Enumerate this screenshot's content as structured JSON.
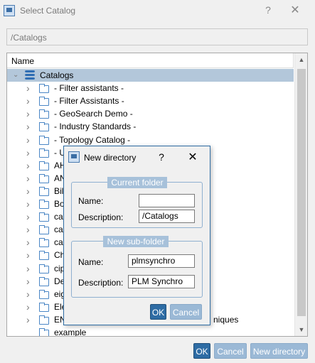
{
  "window": {
    "title": "Select Catalog",
    "help": "?",
    "close": "✕",
    "path": "/Catalogs"
  },
  "tree": {
    "header": "Name",
    "root_label": "Catalogs",
    "items": [
      "- Filter assistants -",
      "- Filter Assistants -",
      "- GeoSearch Demo -",
      "- Industry Standards -",
      "- Topology Catalog -",
      "- U",
      "AH",
      "AN",
      "Bil",
      "Bo",
      "ca",
      "ca",
      "ca",
      "Ch",
      "cip",
      "De",
      "eig",
      "Ele",
      "EN",
      "example"
    ],
    "item_18_tail": "niques"
  },
  "buttons": {
    "ok": "OK",
    "cancel": "Cancel",
    "new_directory": "New directory"
  },
  "dialog": {
    "title": "New directory",
    "help": "?",
    "close": "✕",
    "current_folder": {
      "title": "Current folder",
      "name_label": "Name:",
      "name_value": "",
      "description_label": "Description:",
      "description_value": "/Catalogs"
    },
    "new_sub_folder": {
      "title": "New sub-folder",
      "name_label": "Name:",
      "name_value": "plmsynchro",
      "description_label": "Description:",
      "description_value": "PLM Synchro"
    },
    "ok": "OK",
    "cancel": "Cancel"
  },
  "colors": {
    "accent": "#2e6ca4",
    "selection": "#b3c7da",
    "disabled_button": "#9bb9d6"
  }
}
